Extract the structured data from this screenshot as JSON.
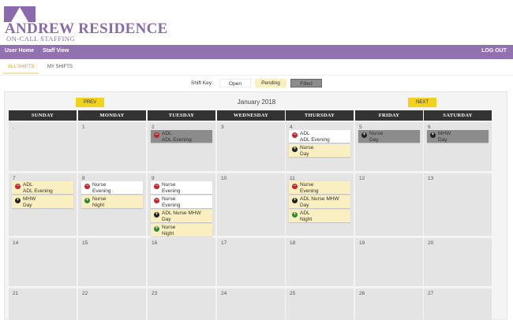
{
  "logo": {
    "title": "ANDREW RESIDENCE",
    "subtitle": "ON-CALL STAFFING",
    "color": "#8a6aad"
  },
  "nav": {
    "home": "User Home",
    "staff": "Staff View",
    "logout": "LOG OUT",
    "color": "#9271b1"
  },
  "tabs": {
    "all": "ALL SHIFTS",
    "mine": "MY SHIFTS",
    "active": "all"
  },
  "key": {
    "label": "Shift Key:",
    "open": "Open",
    "pending": "Pending",
    "filled": "Filled"
  },
  "calendar": {
    "month": "January 2018",
    "prev": "PREV",
    "next": "NEXT",
    "days": [
      "SUNDAY",
      "MONDAY",
      "TUESDAY",
      "WEDNESDAY",
      "THURSDAY",
      "FRIDAY",
      "SATURDAY"
    ],
    "weeks": [
      [
        ".",
        "1",
        "2",
        "3",
        "4",
        "5",
        "6"
      ],
      [
        "7",
        "8",
        "9",
        "10",
        "11",
        "12",
        "13"
      ],
      [
        "14",
        "15",
        "16",
        "17",
        "18",
        "19",
        "20"
      ],
      [
        "21",
        "22",
        "23",
        "24",
        "25",
        "26",
        "27"
      ]
    ],
    "shifts": [
      {
        "week": 0,
        "day": 2,
        "slot": 0,
        "l1": "ADL",
        "l2": "ADL Evening",
        "status": "filled",
        "icon": "red"
      },
      {
        "week": 0,
        "day": 4,
        "slot": 0,
        "l1": "ADL",
        "l2": "ADL Evening",
        "status": "open",
        "icon": "red"
      },
      {
        "week": 0,
        "day": 4,
        "slot": 1,
        "l1": "Nurse",
        "l2": "Day",
        "status": "pending",
        "icon": "black"
      },
      {
        "week": 0,
        "day": 5,
        "slot": 0,
        "l1": "Nurse",
        "l2": "Day",
        "status": "filled",
        "icon": "black"
      },
      {
        "week": 0,
        "day": 6,
        "slot": 0,
        "l1": "MHW",
        "l2": "Day",
        "status": "filled",
        "icon": "black"
      },
      {
        "week": 1,
        "day": 0,
        "slot": 0,
        "l1": "ADL",
        "l2": "ADL Evening",
        "status": "pending",
        "icon": "red"
      },
      {
        "week": 1,
        "day": 0,
        "slot": 1,
        "l1": "MHW",
        "l2": "Day",
        "status": "pending",
        "icon": "black"
      },
      {
        "week": 1,
        "day": 1,
        "slot": 0,
        "l1": "Nurse",
        "l2": "Evening",
        "status": "open",
        "icon": "red"
      },
      {
        "week": 1,
        "day": 1,
        "slot": 1,
        "l1": "Nurse",
        "l2": "Night",
        "status": "pending",
        "icon": "green"
      },
      {
        "week": 1,
        "day": 2,
        "slot": 0,
        "l1": "Nurse",
        "l2": "Evening",
        "status": "open",
        "icon": "red"
      },
      {
        "week": 1,
        "day": 2,
        "slot": 1,
        "l1": "Nurse",
        "l2": "Evening",
        "status": "open",
        "icon": "red"
      },
      {
        "week": 1,
        "day": 2,
        "slot": 2,
        "l1": "ADL Nurse MHW",
        "l2": "Day",
        "status": "pending",
        "icon": "black"
      },
      {
        "week": 1,
        "day": 2,
        "slot": 3,
        "l1": "Nurse",
        "l2": "Night",
        "status": "pending",
        "icon": "green"
      },
      {
        "week": 1,
        "day": 4,
        "slot": 0,
        "l1": "Nurse",
        "l2": "Evening",
        "status": "pending",
        "icon": "red"
      },
      {
        "week": 1,
        "day": 4,
        "slot": 1,
        "l1": "ADL Nurse MHW",
        "l2": "Day",
        "status": "pending",
        "icon": "black"
      },
      {
        "week": 1,
        "day": 4,
        "slot": 2,
        "l1": "ADL",
        "l2": "Night",
        "status": "pending",
        "icon": "green"
      }
    ]
  },
  "colors": {
    "accent": "#f2d21b",
    "open": "#ffffff",
    "pending": "#f9efc0",
    "filled": "#8c8c8c"
  }
}
